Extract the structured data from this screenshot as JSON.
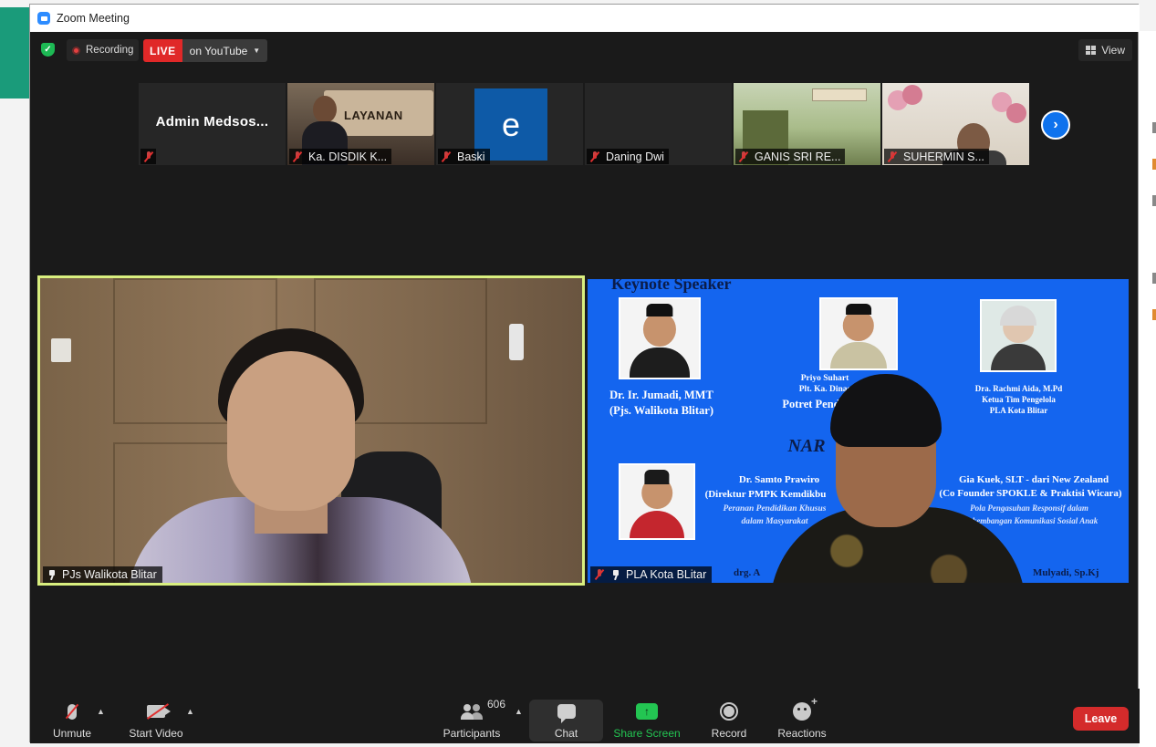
{
  "window": {
    "title": "Zoom Meeting"
  },
  "topbar": {
    "recording_label": "Recording",
    "live_badge": "LIVE",
    "live_destination": "on YouTube",
    "view_label": "View"
  },
  "thumbnails": [
    {
      "display_name": "Admin  Medsos...",
      "label": "",
      "muted": true
    },
    {
      "label": "Ka. DISDIK K...",
      "banner_text": "LAYANAN",
      "muted": true
    },
    {
      "label": "Baski",
      "avatar_letter": "e",
      "muted": true
    },
    {
      "label": "Daning Dwi",
      "muted": true
    },
    {
      "label": "GANIS SRI RE...",
      "muted": true
    },
    {
      "label": "SUHERMIN S...",
      "muted": true
    }
  ],
  "main_tiles": {
    "left": {
      "label": "PJs Walikota Blitar",
      "pinned": true,
      "muted": false
    },
    "right": {
      "label": "PLA Kota BLitar",
      "pinned": true,
      "muted": true,
      "slide": {
        "header": "Keynote Speaker",
        "sp1_name": "Dr. Ir. Jumadi, MMT",
        "sp1_role": "(Pjs. Walikota Blitar)",
        "sp2_name": "Priyo Suhart",
        "sp2_role": "Plt. Ka. Dinas",
        "sp2_topic": "Potret Pend",
        "sp3_name": "Dra. Rachmi Aida, M.Pd",
        "sp3_role": "Ketua Tim Pengelola",
        "sp3_org": "PLA Kota Blitar",
        "nara": "NAR",
        "sp4_name": "Dr. Samto Prawiro",
        "sp4_role": "(Direktur PMPK Kemdikbu",
        "sp4_topic1": "Peranan Pendidikan Khusus",
        "sp4_topic2": "dalam Masyarakat",
        "sp5_name": "Gia Kuek, SLT - dari New Zealand",
        "sp5_role": "(Co Founder SPOKLE & Praktisi Wicara)",
        "sp5_topic1": "Pola Pengasuhan Responsif dalam",
        "sp5_topic2": "Perkembangan Komunikasi Sosial Anak",
        "bottom_left": "drg. A",
        "bottom_right": "Mulyadi, Sp.Kj"
      }
    }
  },
  "toolbar": {
    "unmute": "Unmute",
    "start_video": "Start Video",
    "participants": "Participants",
    "participants_count": "606",
    "chat": "Chat",
    "share_screen": "Share Screen",
    "record": "Record",
    "reactions": "Reactions",
    "leave": "Leave"
  },
  "colors": {
    "share_green": "#23c552",
    "leave_red": "#d42b2b",
    "active_speaker_border": "#d9ef7f",
    "live_red": "#e02828",
    "slide_blue": "#1465ef"
  }
}
